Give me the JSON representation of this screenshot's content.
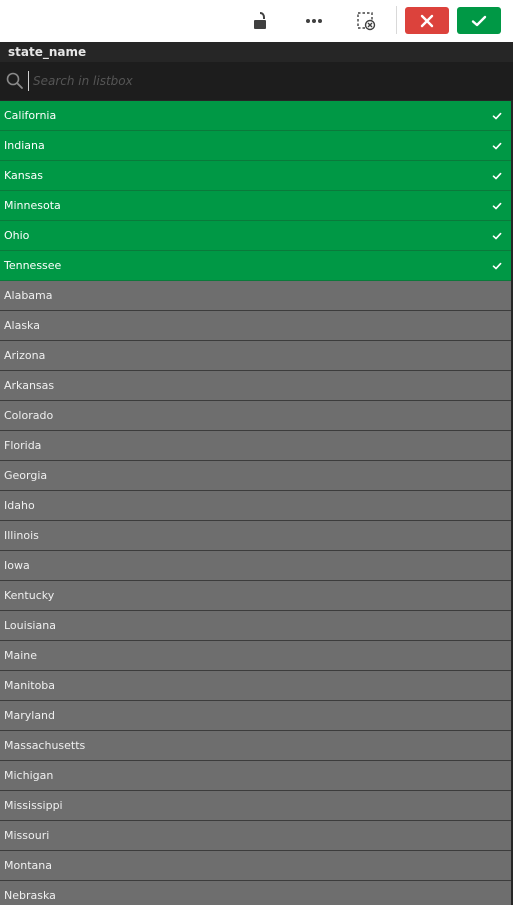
{
  "toolbar": {
    "lock_icon": "unlock-icon",
    "more_icon": "more-options-icon",
    "clear_icon": "clear-selection-icon",
    "cancel_icon": "close-icon",
    "confirm_icon": "check-icon",
    "colors": {
      "cancel": "#dc423c",
      "confirm": "#009845"
    }
  },
  "listbox": {
    "title": "state_name",
    "search_placeholder": "Search in listbox"
  },
  "colors": {
    "selected": "#009845",
    "possible": "#6e6e6e",
    "panel": "#262626"
  },
  "items": [
    {
      "label": "California",
      "state": "selected"
    },
    {
      "label": "Indiana",
      "state": "selected"
    },
    {
      "label": "Kansas",
      "state": "selected"
    },
    {
      "label": "Minnesota",
      "state": "selected"
    },
    {
      "label": "Ohio",
      "state": "selected"
    },
    {
      "label": "Tennessee",
      "state": "selected"
    },
    {
      "label": "Alabama",
      "state": "possible"
    },
    {
      "label": "Alaska",
      "state": "possible"
    },
    {
      "label": "Arizona",
      "state": "possible"
    },
    {
      "label": "Arkansas",
      "state": "possible"
    },
    {
      "label": "Colorado",
      "state": "possible"
    },
    {
      "label": "Florida",
      "state": "possible"
    },
    {
      "label": "Georgia",
      "state": "possible"
    },
    {
      "label": "Idaho",
      "state": "possible"
    },
    {
      "label": "Illinois",
      "state": "possible"
    },
    {
      "label": "Iowa",
      "state": "possible"
    },
    {
      "label": "Kentucky",
      "state": "possible"
    },
    {
      "label": "Louisiana",
      "state": "possible"
    },
    {
      "label": "Maine",
      "state": "possible"
    },
    {
      "label": "Manitoba",
      "state": "possible"
    },
    {
      "label": "Maryland",
      "state": "possible"
    },
    {
      "label": "Massachusetts",
      "state": "possible"
    },
    {
      "label": "Michigan",
      "state": "possible"
    },
    {
      "label": "Mississippi",
      "state": "possible"
    },
    {
      "label": "Missouri",
      "state": "possible"
    },
    {
      "label": "Montana",
      "state": "possible"
    },
    {
      "label": "Nebraska",
      "state": "possible"
    }
  ]
}
